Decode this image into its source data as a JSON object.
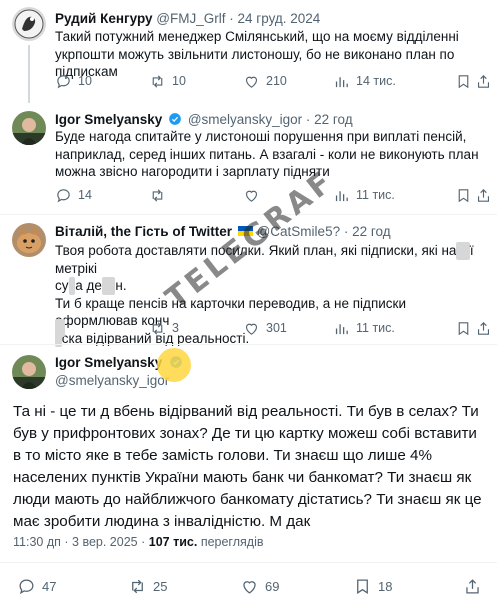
{
  "tweets": [
    {
      "name": "Рудий Кенгуру",
      "handle": "@FMJ_Grlf",
      "sep": "·",
      "date": "24 груд. 2024",
      "text": "Такий потужний менеджер Смілянський, що на моєму відділенні укрпошти можуть звільнити листоношу, бо не виконано план по підпискам",
      "replies": "10",
      "reposts": "10",
      "likes": "210",
      "views": "14 тис."
    },
    {
      "name": "Igor Smelyansky",
      "handle": "@smelyansky_igor",
      "sep": "·",
      "date": "22 год",
      "text": "Буде нагода спитайте у листоноші порушення при виплаті пенсій, наприклад, серед інших питань. А взагалі - коли не виконують план можна звісно нагородити і зарплату підняти",
      "replies": "14",
      "reposts": "",
      "likes": "",
      "views": "11 тис."
    },
    {
      "name": "Віталій, the Гість of Twitter",
      "handle": "@CatSmile5?",
      "sep": "·",
      "date": "22 год",
      "line1": "Твоя робота доставляти посилки. Який план, які підписки, які на",
      "line1b": "ї метрікі",
      "line2a": "су",
      "line2b": "а де",
      "line2c": "н.",
      "line3": "Ти б краще пенсів на карточки переводив, а не підписки оформлював конч",
      "line4a": "",
      "line4b": "ска відірваний від реальності.",
      "replies": "",
      "reposts": "3",
      "likes": "301",
      "views": "11 тис."
    }
  ],
  "main": {
    "name": "Igor Smelyansky",
    "handle": "@smelyansky_igor",
    "text": "Та ні - це ти д  вбень відірваний від реальності. Ти був в селах? Ти був у прифронтових зонах? Де ти цю картку можеш собі вставити в то місто яке в тебе замість голови. Ти знаєш що лише 4% населених пунктів України мають банк чи банкомат? Ти знаєш як люди мають до найближчого банкомату дістатись? Ти знаєш як це має зробити людина з інвалідністю. М  дак",
    "time": "11:30 дп",
    "dot": "·",
    "date": "3 вер. 2025",
    "views_count": "107 тис.",
    "views_label": "переглядів",
    "replies": "47",
    "reposts": "25",
    "likes": "69",
    "bookmarks": "18"
  },
  "watermark": "TELEGRAF",
  "colors": {
    "text": "#0f1419",
    "secondary": "#536471",
    "verified": "#1d9bf0",
    "divider": "#eff3f4"
  },
  "icons": [
    "reply-icon",
    "repost-icon",
    "like-icon",
    "views-icon",
    "bookmark-icon",
    "share-icon",
    "verified-badge-icon",
    "ukraine-flag-icon"
  ]
}
